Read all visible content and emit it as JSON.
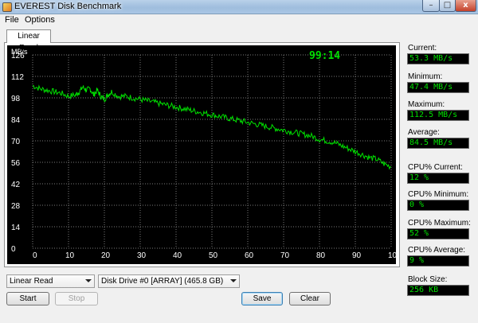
{
  "window": {
    "title": "EVEREST Disk Benchmark",
    "buttons": {
      "minimize": "–",
      "maximize": "□",
      "close": "x"
    }
  },
  "menu": [
    "File",
    "Options"
  ],
  "tab": {
    "label": "Linear Read"
  },
  "graph": {
    "timer": "99:14",
    "y_unit": "MB/s",
    "y_ticks": [
      "126",
      "112",
      "98",
      "84",
      "70",
      "56",
      "42",
      "28",
      "14",
      "0"
    ],
    "x_ticks": [
      "0",
      "10",
      "20",
      "30",
      "40",
      "50",
      "60",
      "70",
      "80",
      "90",
      "100 %"
    ],
    "y_max": 126,
    "x_max": 100,
    "colors": {
      "background": "#000000",
      "grid": "#7a7a7a",
      "trace": "#00e000",
      "labels": "#ffffff"
    },
    "series": {
      "name": "",
      "points": [
        [
          0,
          106
        ],
        [
          2,
          104
        ],
        [
          4,
          103
        ],
        [
          6,
          102
        ],
        [
          8,
          101
        ],
        [
          10,
          99
        ],
        [
          12,
          100
        ],
        [
          13,
          102
        ],
        [
          14,
          105
        ],
        [
          15,
          103
        ],
        [
          16,
          104
        ],
        [
          17,
          100
        ],
        [
          18,
          103
        ],
        [
          19,
          99
        ],
        [
          20,
          97
        ],
        [
          21,
          100
        ],
        [
          22,
          102
        ],
        [
          24,
          99
        ],
        [
          26,
          99
        ],
        [
          28,
          98
        ],
        [
          30,
          97
        ],
        [
          32,
          96
        ],
        [
          34,
          95
        ],
        [
          36,
          94
        ],
        [
          38,
          93
        ],
        [
          40,
          92
        ],
        [
          42,
          91
        ],
        [
          44,
          90
        ],
        [
          46,
          89
        ],
        [
          48,
          88
        ],
        [
          50,
          87
        ],
        [
          52,
          86
        ],
        [
          54,
          85
        ],
        [
          56,
          84
        ],
        [
          58,
          83
        ],
        [
          60,
          82
        ],
        [
          62,
          81
        ],
        [
          64,
          80
        ],
        [
          66,
          79
        ],
        [
          68,
          78
        ],
        [
          70,
          77
        ],
        [
          72,
          76
        ],
        [
          74,
          75
        ],
        [
          76,
          74
        ],
        [
          78,
          73
        ],
        [
          80,
          71
        ],
        [
          82,
          70
        ],
        [
          84,
          69
        ],
        [
          86,
          67
        ],
        [
          88,
          65
        ],
        [
          90,
          63
        ],
        [
          92,
          61
        ],
        [
          94,
          59
        ],
        [
          96,
          58
        ],
        [
          98,
          55
        ],
        [
          100,
          53
        ]
      ]
    }
  },
  "stats": [
    {
      "label": "Current:",
      "value": "53.3 MB/s"
    },
    {
      "label": "Minimum:",
      "value": "47.4 MB/s"
    },
    {
      "label": "Maximum:",
      "value": "112.5 MB/s"
    },
    {
      "label": "Average:",
      "value": "84.5 MB/s"
    },
    {
      "label": "CPU% Current:",
      "value": "12 %"
    },
    {
      "label": "CPU% Minimum:",
      "value": "0 %"
    },
    {
      "label": "CPU% Maximum:",
      "value": "52 %"
    },
    {
      "label": "CPU% Average:",
      "value": "9 %"
    },
    {
      "label": "Block Size:",
      "value": "256 KB"
    }
  ],
  "controls": {
    "test_select": "Linear Read",
    "drive_select": "Disk Drive #0  [ARRAY]  (465.8 GB)",
    "start": "Start",
    "stop": "Stop",
    "save": "Save",
    "clear": "Clear"
  }
}
